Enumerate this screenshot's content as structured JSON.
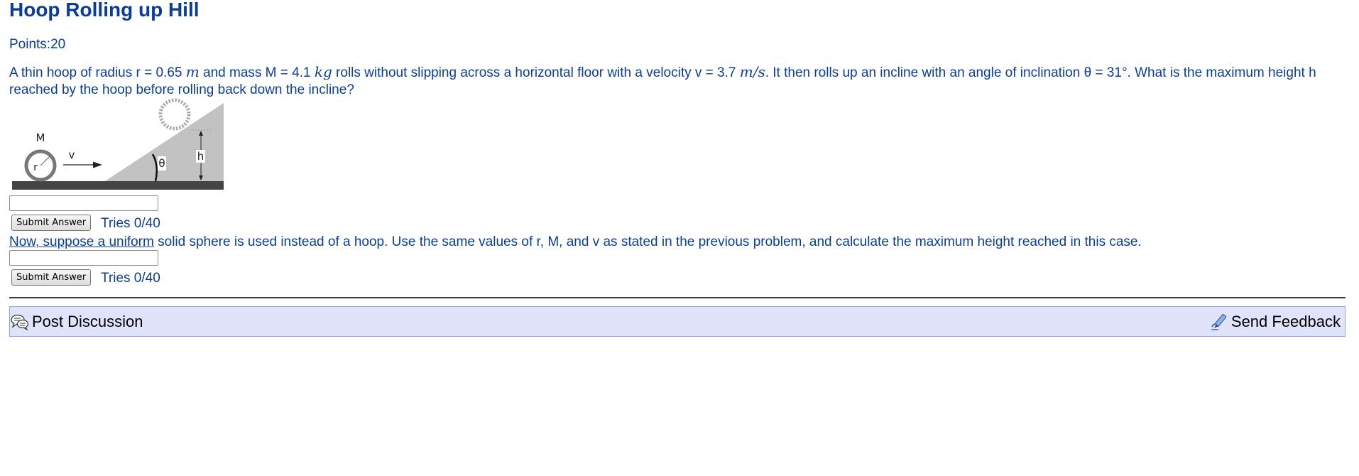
{
  "problem": {
    "title": "Hoop Rolling up Hill",
    "points": "Points:20",
    "q1": {
      "seg1": "A thin hoop of radius r = 0.65 ",
      "unit_r": "m",
      "seg2": " and mass M = 4.1 ",
      "unit_m": "kg",
      "seg3": " rolls without slipping across a horizontal floor with a velocity v = 3.7 ",
      "unit_v": "m/s",
      "seg4": ". It then rolls up an incline with an angle of inclination θ = 31°. What is the maximum height h reached by the hoop before rolling back down the incline?"
    },
    "figure_labels": {
      "mass": "M",
      "radius": "r",
      "velocity": "v",
      "angle": "θ",
      "height": "h"
    },
    "q2": {
      "linked": "Now, suppose a uniform",
      "rest": " solid sphere is used instead of a hoop. Use the same values of r, M, and v as stated in the previous problem, and calculate the maximum height reached in this case."
    },
    "answer1": {
      "value": "",
      "submit_label": "Submit Answer",
      "tries": "Tries 0/40"
    },
    "answer2": {
      "value": "",
      "submit_label": "Submit Answer",
      "tries": "Tries 0/40"
    }
  },
  "footer": {
    "post_discussion": "Post Discussion",
    "send_feedback": "Send Feedback"
  },
  "colors": {
    "text": "#0a3d9b",
    "bar_background": "#e1e3fb",
    "bar_border": "#8ba5e6"
  },
  "icons": {
    "discussion": "speech-bubbles-icon",
    "feedback": "pen-feedback-icon"
  }
}
